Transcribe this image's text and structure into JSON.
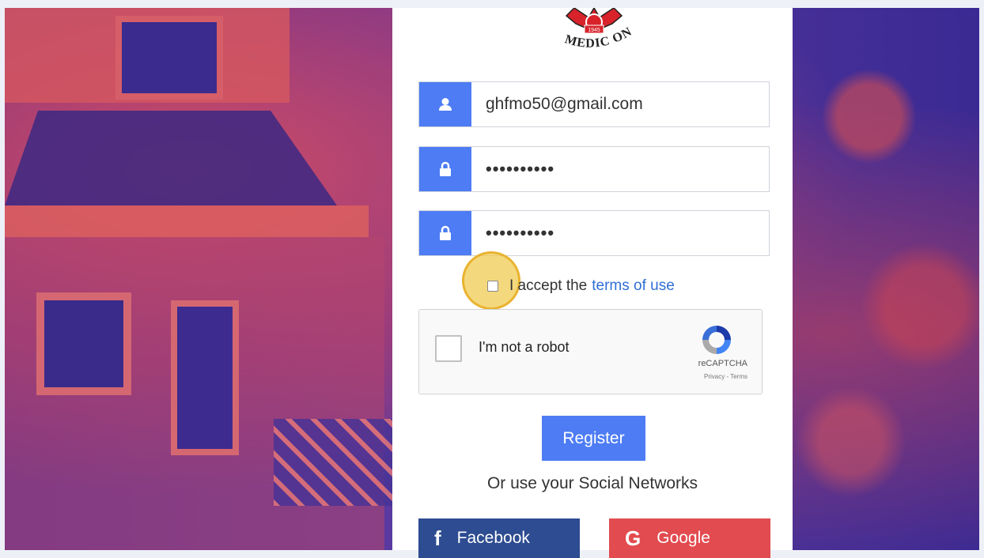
{
  "logo": {
    "year": "1945",
    "name": "MEDIC ONE"
  },
  "form": {
    "email_value": "ghfmo50@gmail.com",
    "password_value": "••••••••••",
    "confirm_password_value": "••••••••••",
    "terms_prefix": "I accept the",
    "terms_link": "terms of use"
  },
  "captcha": {
    "label": "I'm not a robot",
    "brand": "reCAPTCHA",
    "links": "Privacy - Terms"
  },
  "register_label": "Register",
  "social": {
    "label": "Or use your Social Networks",
    "facebook_label": "Facebook",
    "facebook_icon": "f",
    "google_label": "Google",
    "google_icon": "G"
  },
  "colors": {
    "primary": "#4d7cf4",
    "facebook": "#2d4c91",
    "google": "#e24b4f",
    "link": "#2f6fd6"
  }
}
